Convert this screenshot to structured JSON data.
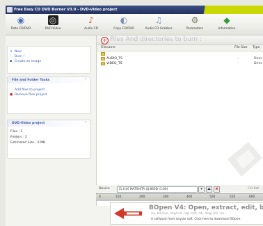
{
  "window": {
    "title": "Free Easy CD DVD Burner V3.0 - DVD-Video project"
  },
  "toolbar": {
    "items": [
      {
        "label": "Data CD/DVD",
        "icon": "disc-icon"
      },
      {
        "label": "DVD-Video",
        "icon": "dvd-video-icon"
      },
      {
        "label": "Audio CD",
        "icon": "audio-cd-icon"
      },
      {
        "label": "Copy CD/DVD",
        "icon": "copy-disc-icon"
      },
      {
        "label": "Audio CD Grabber",
        "icon": "grabber-icon"
      },
      {
        "label": "Parameters",
        "icon": "gear-icon"
      },
      {
        "label": "Information",
        "icon": "info-icon"
      }
    ]
  },
  "actions": {
    "items": [
      "New",
      "Burn !",
      "Create an image"
    ]
  },
  "file_tasks": {
    "title": "File and Folder Tasks",
    "items": [
      "Add files to project",
      "Remove files project"
    ]
  },
  "project": {
    "title": "DVD-Video project",
    "files": "Files : 2",
    "folders": "Folders : 2",
    "size": "Estimated Size : 0 MB"
  },
  "main": {
    "title": "Files And directories to burn :",
    "columns": {
      "name": "Filename",
      "size": "File Size",
      "type": "Type"
    },
    "rows": [
      {
        "name": "..",
        "size": "",
        "type": ""
      },
      {
        "name": "AUDIO_TS",
        "size": "-",
        "type": "Direc"
      },
      {
        "name": "VIDEO_TS",
        "size": "-",
        "type": "Direc"
      }
    ]
  },
  "device": {
    "label": "Device",
    "value": "[1:0:0] MATSHITA UJ-860D (1:00)",
    "speed": "CD:RW"
  },
  "ruler": {
    "ticks": [
      "0",
      "150",
      "200",
      "300",
      "400",
      "500",
      "550",
      "600"
    ]
  },
  "banner": {
    "title": "BOpen V4: Open, extract, edit, bu",
    "subtitle": "iso, bin/cue, img/ccd, nrg, mdf, cdi, dmg, b5i, iso...",
    "footer": "A software from Issyste soft. Click here to download ISOpen."
  },
  "colors": {
    "title_bar": "#2e3f74",
    "accent": "#c8d800",
    "link": "#3a5cb0"
  }
}
